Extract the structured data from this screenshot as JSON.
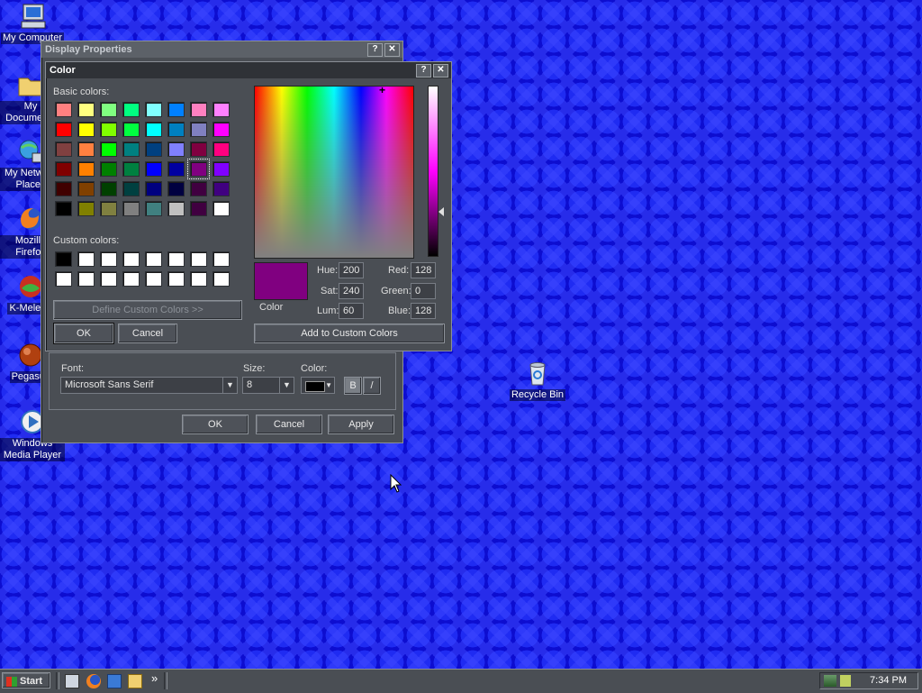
{
  "desktop": {
    "icons": [
      {
        "label": "My Computer",
        "icon": "computer-icon"
      },
      {
        "label": "My Documents",
        "icon": "folder-icon"
      },
      {
        "label": "My Network Places",
        "icon": "network-icon"
      },
      {
        "label": "Mozilla Firefox",
        "icon": "firefox-icon"
      },
      {
        "label": "K-Meleon",
        "icon": "kmeleon-icon"
      },
      {
        "label": "Pegasus",
        "icon": "pegasus-icon"
      },
      {
        "label": "Windows Media Player",
        "icon": "media-player-icon"
      },
      {
        "label": "Recycle Bin",
        "icon": "recycle-bin-icon"
      }
    ]
  },
  "display_properties": {
    "title": "Display Properties",
    "font_label": "Font:",
    "font_value": "Microsoft Sans Serif",
    "size_label": "Size:",
    "size_value": "8",
    "color_label": "Color:",
    "bold_label": "B",
    "italic_label": "/",
    "ok_label": "OK",
    "cancel_label": "Cancel",
    "apply_label": "Apply"
  },
  "color_dialog": {
    "title": "Color",
    "basic_colors_label": "Basic colors:",
    "custom_colors_label": "Custom colors:",
    "define_custom_label": "Define Custom Colors >>",
    "ok_label": "OK",
    "cancel_label": "Cancel",
    "add_custom_label": "Add to Custom Colors",
    "color_solid_label": "Color",
    "hue_label": "Hue:",
    "hue_value": "200",
    "sat_label": "Sat:",
    "sat_value": "240",
    "lum_label": "Lum:",
    "lum_value": "60",
    "red_label": "Red:",
    "red_value": "128",
    "green_label": "Green:",
    "green_value": "0",
    "blue_label": "Blue:",
    "blue_value": "128",
    "selected_color": "#800080",
    "basic_colors": [
      [
        "#ff8080",
        "#ffff80",
        "#80ff80",
        "#00ff80",
        "#80ffff",
        "#0080ff",
        "#ff80c0",
        "#ff80ff"
      ],
      [
        "#ff0000",
        "#ffff00",
        "#80ff00",
        "#00ff40",
        "#00ffff",
        "#0080c0",
        "#8080c0",
        "#ff00ff"
      ],
      [
        "#804040",
        "#ff8040",
        "#00ff00",
        "#008080",
        "#004080",
        "#8080ff",
        "#800040",
        "#ff0080"
      ],
      [
        "#800000",
        "#ff8000",
        "#008000",
        "#008040",
        "#0000ff",
        "#0000a0",
        "#800080",
        "#8000ff"
      ],
      [
        "#400000",
        "#804000",
        "#004000",
        "#004040",
        "#000080",
        "#000040",
        "#400040",
        "#400080"
      ],
      [
        "#000000",
        "#808000",
        "#808040",
        "#808080",
        "#408080",
        "#c0c0c0",
        "#400040",
        "#ffffff"
      ]
    ],
    "custom_colors": [
      [
        "#000000",
        "#ffffff",
        "#ffffff",
        "#ffffff",
        "#ffffff",
        "#ffffff",
        "#ffffff",
        "#ffffff"
      ],
      [
        "#ffffff",
        "#ffffff",
        "#ffffff",
        "#ffffff",
        "#ffffff",
        "#ffffff",
        "#ffffff",
        "#ffffff"
      ]
    ]
  },
  "taskbar": {
    "start_label": "Start",
    "quick_launch": [
      "desktop-icon",
      "firefox-icon",
      "outlook-icon",
      "explorer-icon"
    ],
    "chevron": "»",
    "clock": "7:34 PM"
  }
}
